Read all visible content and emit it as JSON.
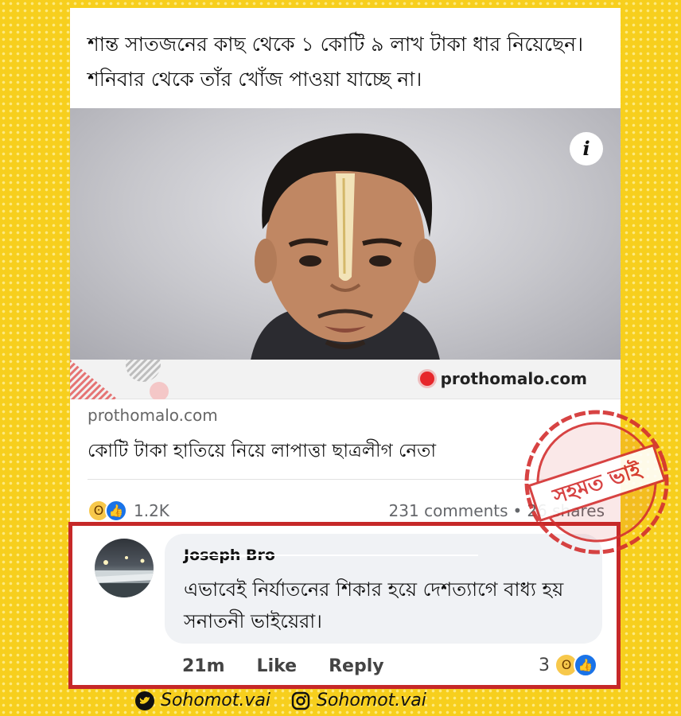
{
  "post": {
    "text": "শান্ত সাতজনের কাছ থেকে ১ কোটি ৯ লাখ টাকা ধার নিয়েছেন। শনিবার থেকে তাঁর খোঁজ পাওয়া যাচ্ছে না।",
    "info_icon": "info-icon",
    "image_brand": "prothomalo.com"
  },
  "link_preview": {
    "domain": "prothomalo.com",
    "title": "কোটি টাকা হাতিয়ে নিয়ে লাপাত্তা ছাত্রলীগ নেতা"
  },
  "reactions": {
    "icons": [
      "haha-icon",
      "like-icon"
    ],
    "count": "1.2K",
    "comments": "231 comments",
    "separator": "•",
    "shares": "26 shares"
  },
  "comment": {
    "author": "Joseph Bro",
    "text": "এভাবেই নির্যাতনের শিকার হয়ে দেশত্যাগে বাধ্য হয় সনাতনী ভাইয়েরা।",
    "time": "21m",
    "like_label": "Like",
    "reply_label": "Reply",
    "reaction_count": "3"
  },
  "stamp": {
    "text": "সহমত ভাই",
    "color": "#d32f2f"
  },
  "footer": {
    "twitter_icon": "twitter-icon",
    "twitter_handle": "Sohomot.vai",
    "instagram_icon": "instagram-icon",
    "instagram_handle": "Sohomot.vai"
  },
  "colors": {
    "background": "#f7cf1d",
    "highlight_border": "#c62828",
    "like_blue": "#1a73e8"
  }
}
